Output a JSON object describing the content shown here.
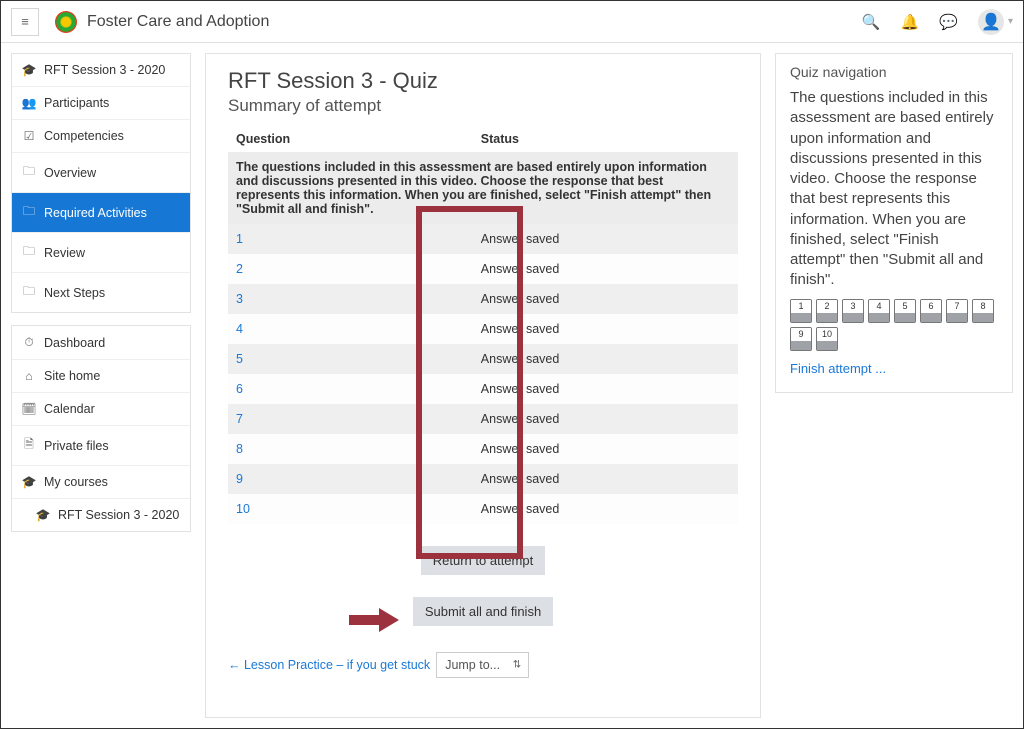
{
  "header": {
    "site_name": "Foster Care and Adoption"
  },
  "sidebar_course": [
    {
      "icon": "🎓",
      "label": "RFT Session 3 - 2020",
      "name": "nav-course-title"
    },
    {
      "icon": "👥",
      "label": "Participants",
      "name": "nav-participants"
    },
    {
      "icon": "☑",
      "label": "Competencies",
      "name": "nav-competencies"
    },
    {
      "icon": "🗀",
      "label": "Overview",
      "name": "nav-overview"
    },
    {
      "icon": "🗀",
      "label": "Required Activities",
      "name": "nav-required-activities",
      "active": true
    },
    {
      "icon": "🗀",
      "label": "Review",
      "name": "nav-review"
    },
    {
      "icon": "🗀",
      "label": "Next Steps",
      "name": "nav-next-steps"
    }
  ],
  "sidebar_global": [
    {
      "icon": "⏱",
      "label": "Dashboard",
      "name": "nav-dashboard"
    },
    {
      "icon": "⌂",
      "label": "Site home",
      "name": "nav-site-home"
    },
    {
      "icon": "🗓",
      "label": "Calendar",
      "name": "nav-calendar"
    },
    {
      "icon": "🗎",
      "label": "Private files",
      "name": "nav-private-files"
    },
    {
      "icon": "🎓",
      "label": "My courses",
      "name": "nav-my-courses"
    },
    {
      "icon": "🎓",
      "label": "RFT Session 3 - 2020",
      "name": "nav-my-course-rft",
      "indent": true
    }
  ],
  "main": {
    "title": "RFT Session 3 - Quiz",
    "subtitle": "Summary of attempt",
    "cols": {
      "question": "Question",
      "status": "Status"
    },
    "info_text": "The questions included in this assessment are based entirely upon information and discussions presented in this video. Choose the response that best represents this information. When you are finished, select \"Finish attempt\" then \"Submit all and finish\".",
    "rows": [
      {
        "q": "1",
        "status": "Answer saved"
      },
      {
        "q": "2",
        "status": "Answer saved"
      },
      {
        "q": "3",
        "status": "Answer saved"
      },
      {
        "q": "4",
        "status": "Answer saved"
      },
      {
        "q": "5",
        "status": "Answer saved"
      },
      {
        "q": "6",
        "status": "Answer saved"
      },
      {
        "q": "7",
        "status": "Answer saved"
      },
      {
        "q": "8",
        "status": "Answer saved"
      },
      {
        "q": "9",
        "status": "Answer saved"
      },
      {
        "q": "10",
        "status": "Answer saved"
      }
    ],
    "return_btn": "Return to attempt",
    "submit_btn": "Submit all and finish",
    "prev_link": "← Lesson Practice – if you get stuck",
    "jump_label": "Jump to..."
  },
  "quiznav": {
    "title": "Quiz navigation",
    "desc": "The questions included in this assessment are based entirely upon information and discussions presented in this video. Choose the response that best represents this information. When you are finished, select \"Finish attempt\" then \"Submit all and finish\".",
    "numbers": [
      "1",
      "2",
      "3",
      "4",
      "5",
      "6",
      "7",
      "8",
      "9",
      "10"
    ],
    "finish": "Finish attempt ..."
  }
}
